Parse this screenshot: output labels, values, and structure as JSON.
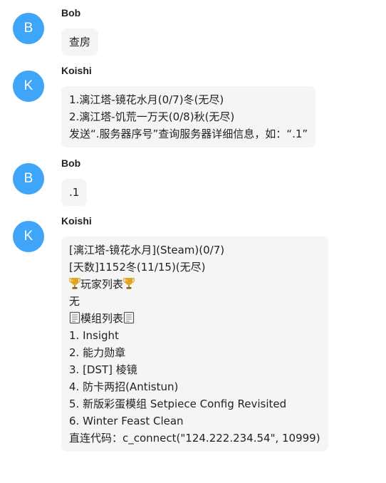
{
  "messages": [
    {
      "sender": "Bob",
      "avatar_letter": "B",
      "lines": [
        "查房"
      ]
    },
    {
      "sender": "Koishi",
      "avatar_letter": "K",
      "lines": [
        "1.漓江塔-镜花水月(0/7)冬(无尽)",
        "2.漓江塔-饥荒一万天(0/8)秋(无尽)",
        "发送“.服务器序号”查询服务器详细信息，如：“.1”"
      ]
    },
    {
      "sender": "Bob",
      "avatar_letter": "B",
      "lines": [
        ".1"
      ]
    },
    {
      "sender": "Koishi",
      "avatar_letter": "K",
      "lines": [
        "[漓江塔-镜花水月](Steam)(0/7)",
        "[天数]1152冬(11/15)(无尽)",
        "玩家列表",
        "无",
        "模组列表",
        "1. Insight",
        "2. 能力勋章",
        "3. [DST] 棱镜",
        "4. 防卡两招(Antistun)",
        "5. 新版彩蛋模组 Setpiece Config Revisited",
        "6. Winter Feast Clean",
        "直连代码：c_connect(\"124.222.234.54\", 10999)"
      ]
    }
  ],
  "icons": {
    "trophy": "trophy-icon",
    "scroll": "scroll-icon"
  },
  "colors": {
    "avatar": "#3ea5f8",
    "bubble": "#f5f5f5",
    "trophy": "#e0a526"
  }
}
